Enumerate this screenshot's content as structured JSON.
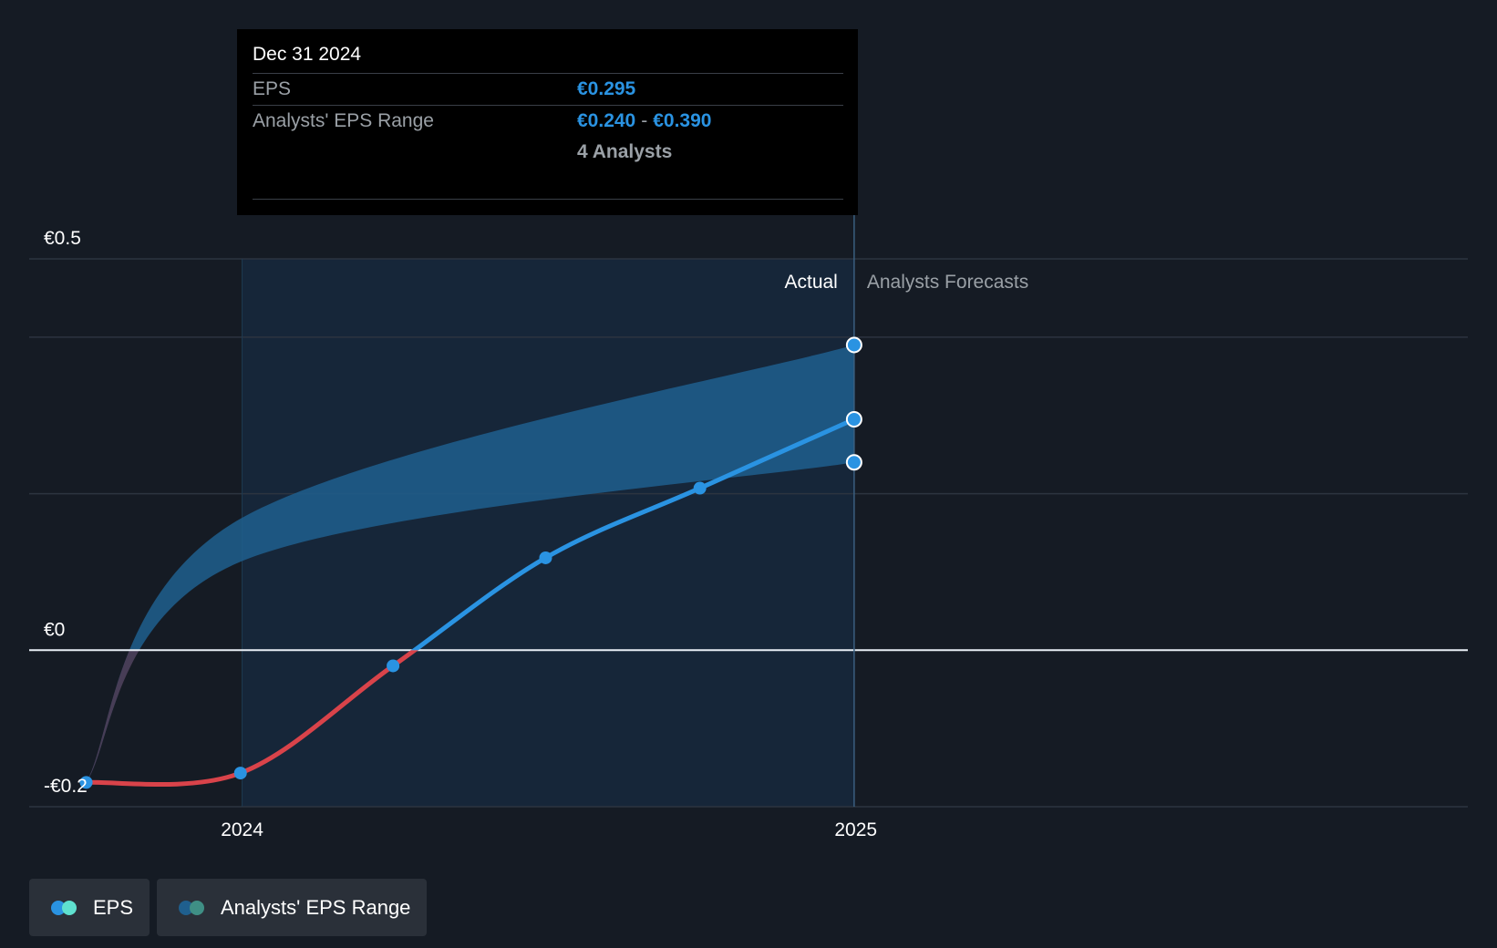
{
  "tooltip": {
    "date": "Dec 31 2024",
    "eps_label": "EPS",
    "eps_value": "€0.295",
    "range_label": "Analysts' EPS Range",
    "range_low": "€0.240",
    "range_sep": "-",
    "range_high": "€0.390",
    "analysts": "4 Analysts"
  },
  "sections": {
    "actual": "Actual",
    "forecast": "Analysts Forecasts"
  },
  "legend": {
    "eps": "EPS",
    "range": "Analysts' EPS Range"
  },
  "colors": {
    "eps_positive": "#2a93e2",
    "eps_negative": "#d9434a",
    "range_fill": "#1f5f8e",
    "background": "#151b24",
    "legend_eps_a": "#2a93e2",
    "legend_eps_b": "#5fe0cf",
    "legend_range_a": "#1f5f8e",
    "legend_range_b": "#3f8f85"
  },
  "chart_data": {
    "type": "line",
    "yticks": [
      {
        "value": 0.5,
        "label": "€0.5"
      },
      {
        "value": 0,
        "label": "€0"
      },
      {
        "value": -0.2,
        "label": "-€0.2"
      }
    ],
    "xticks": [
      {
        "value": "2024-01-01",
        "label": "2024"
      },
      {
        "value": "2025-01-01",
        "label": "2025"
      }
    ],
    "ylim": [
      -0.2,
      0.5
    ],
    "xlim": [
      "2023-08-27",
      "2026-01-01"
    ],
    "gridlines": [
      0.4,
      0.2
    ],
    "actual_region": [
      "2024-01-01",
      "2024-12-31"
    ],
    "series": [
      {
        "name": "EPS",
        "points": [
          {
            "x": "2023-09-30",
            "y": -0.169
          },
          {
            "x": "2023-12-31",
            "y": -0.157
          },
          {
            "x": "2024-03-31",
            "y": -0.02
          },
          {
            "x": "2024-06-30",
            "y": 0.118
          },
          {
            "x": "2024-09-30",
            "y": 0.207
          },
          {
            "x": "2024-12-31",
            "y": 0.295
          }
        ]
      }
    ],
    "range": {
      "name": "Analysts' EPS Range",
      "low": [
        {
          "x": "2023-09-30",
          "y": -0.169
        },
        {
          "x": "2023-12-31",
          "y": 0.113
        },
        {
          "x": "2024-12-31",
          "y": 0.24
        }
      ],
      "high": [
        {
          "x": "2023-09-30",
          "y": -0.169
        },
        {
          "x": "2023-12-31",
          "y": 0.168
        },
        {
          "x": "2024-12-31",
          "y": 0.39
        }
      ]
    }
  }
}
